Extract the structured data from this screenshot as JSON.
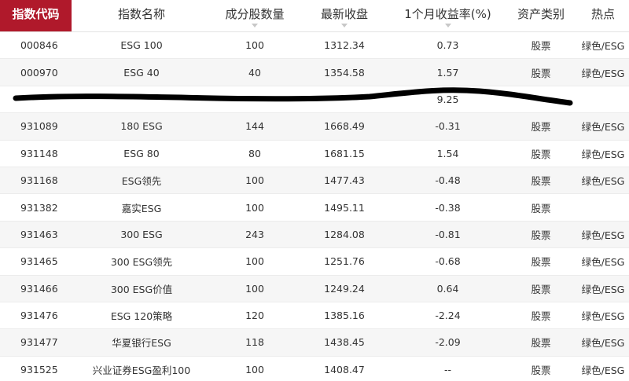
{
  "columns": [
    "指数代码",
    "指数名称",
    "成分股数量",
    "最新收盘",
    "1个月收益率(%)",
    "资产类别",
    "热点"
  ],
  "rows": [
    {
      "code": "000846",
      "name": "ESG 100",
      "count": "100",
      "close": "1312.34",
      "return": "0.73",
      "asset": "股票",
      "hot": "绿色/ESG"
    },
    {
      "code": "000970",
      "name": "ESG 40",
      "count": "40",
      "close": "1354.58",
      "return": "1.57",
      "asset": "股票",
      "hot": "绿色/ESG"
    },
    {
      "code": "",
      "name": "",
      "count": "",
      "close": "",
      "return": "9.25",
      "asset": "",
      "hot": ""
    },
    {
      "code": "931089",
      "name": "180 ESG",
      "count": "144",
      "close": "1668.49",
      "return": "-0.31",
      "asset": "股票",
      "hot": "绿色/ESG"
    },
    {
      "code": "931148",
      "name": "ESG 80",
      "count": "80",
      "close": "1681.15",
      "return": "1.54",
      "asset": "股票",
      "hot": "绿色/ESG"
    },
    {
      "code": "931168",
      "name": "ESG领先",
      "count": "100",
      "close": "1477.43",
      "return": "-0.48",
      "asset": "股票",
      "hot": "绿色/ESG"
    },
    {
      "code": "931382",
      "name": "嘉实ESG",
      "count": "100",
      "close": "1495.11",
      "return": "-0.38",
      "asset": "股票",
      "hot": ""
    },
    {
      "code": "931463",
      "name": "300 ESG",
      "count": "243",
      "close": "1284.08",
      "return": "-0.81",
      "asset": "股票",
      "hot": "绿色/ESG"
    },
    {
      "code": "931465",
      "name": "300 ESG领先",
      "count": "100",
      "close": "1251.76",
      "return": "-0.68",
      "asset": "股票",
      "hot": "绿色/ESG"
    },
    {
      "code": "931466",
      "name": "300 ESG价值",
      "count": "100",
      "close": "1249.24",
      "return": "0.64",
      "asset": "股票",
      "hot": "绿色/ESG"
    },
    {
      "code": "931476",
      "name": "ESG 120策略",
      "count": "120",
      "close": "1385.16",
      "return": "-2.24",
      "asset": "股票",
      "hot": "绿色/ESG"
    },
    {
      "code": "931477",
      "name": "华夏银行ESG",
      "count": "118",
      "close": "1438.45",
      "return": "-2.09",
      "asset": "股票",
      "hot": "绿色/ESG"
    },
    {
      "code": "931525",
      "name": "兴业证券ESG盈利100",
      "count": "100",
      "close": "1408.47",
      "return": "--",
      "asset": "股票",
      "hot": "绿色/ESG"
    }
  ],
  "colors": {
    "accent": "#b0192b",
    "scribble": "#000000"
  }
}
